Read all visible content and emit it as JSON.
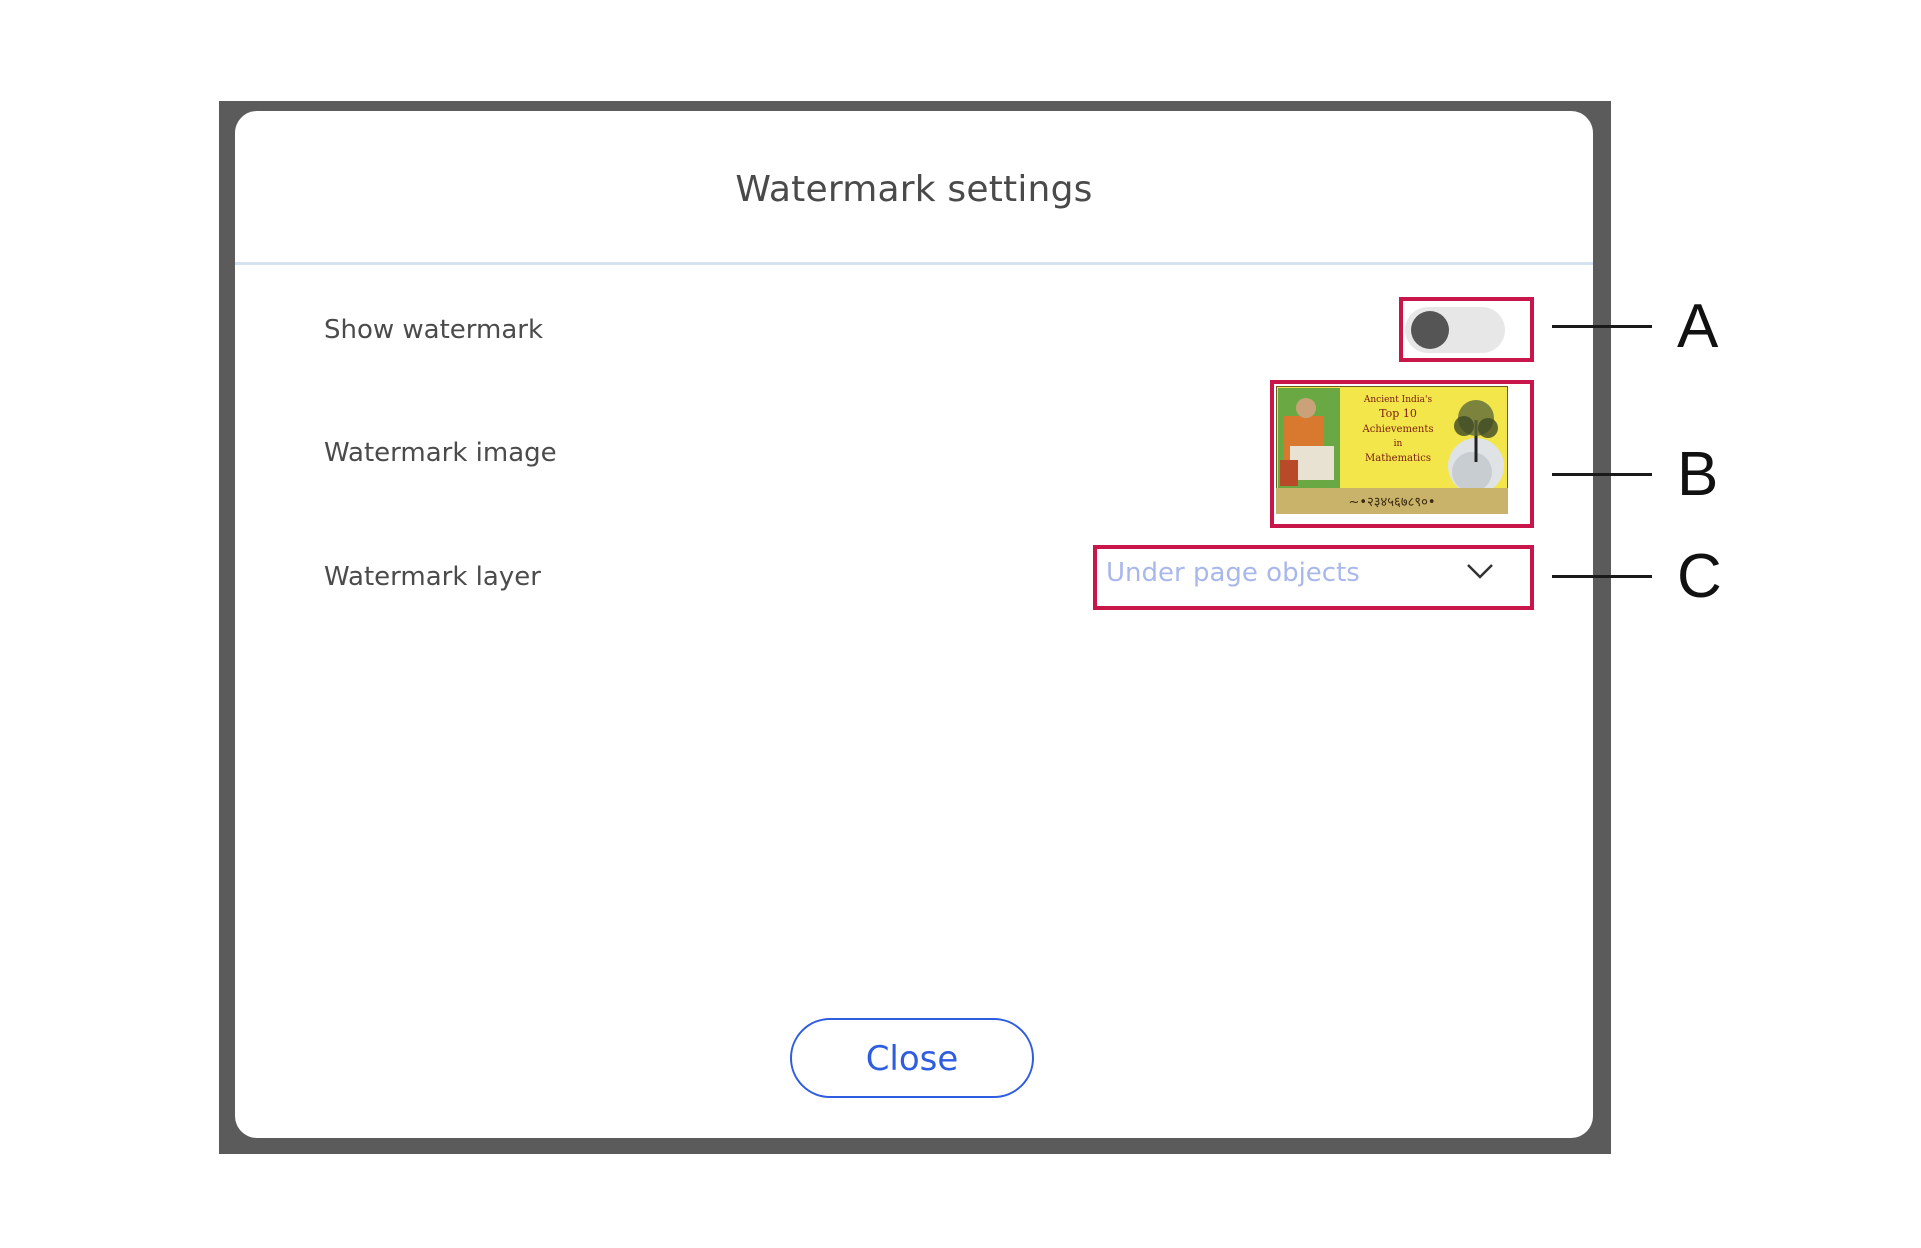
{
  "dialog": {
    "title": "Watermark settings",
    "rows": {
      "show_watermark": {
        "label": "Show watermark",
        "toggle_on": false
      },
      "watermark_image": {
        "label": "Watermark image",
        "thumbnail": {
          "line1": "Ancient India's",
          "line2": "Top 10",
          "line3": "Achievements",
          "line4": "in",
          "line5": "Mathematics",
          "numerals": "~•२३४५६७८९०•"
        }
      },
      "watermark_layer": {
        "label": "Watermark layer",
        "selected": "Under page objects"
      }
    },
    "close_label": "Close"
  },
  "callouts": {
    "a": "A",
    "b": "B",
    "c": "C"
  },
  "colors": {
    "frame": "#5b5b5b",
    "callout_red": "#c8164a",
    "accent_blue": "#2f5de0",
    "dropdown_text": "#a9b8ec"
  }
}
